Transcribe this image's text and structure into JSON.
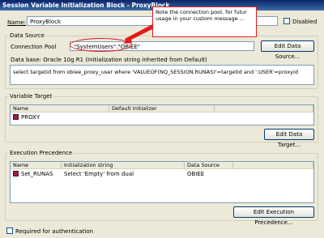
{
  "window": {
    "title": "Session Variable Initialization Block - ProxyBlock"
  },
  "name_label": "Name:",
  "name_value": "ProxyBlock",
  "disabled_label": "Disabled",
  "data_source": {
    "legend": "Data Source",
    "connection_pool_label": "Connection Pool",
    "connection_pool_value": "\"SystemUsers\".\"OBIEE\"",
    "edit_button": "Edit Data Source...",
    "database_text": "Data base: Oracle 10g R1 (Initialization string inherited from Default)",
    "sql": "select targetid from obiee_proxy_user where 'VALUEOF(NQ_SESSION.RUNAS)'=targetid and ':USER'=proxyid"
  },
  "variable_target": {
    "legend": "Variable Target",
    "columns": [
      "Name",
      "Default Initializer"
    ],
    "rows": [
      {
        "name": "PROXY",
        "initializer": ""
      }
    ],
    "edit_button": "Edit Data Target..."
  },
  "execution_precedence": {
    "legend": "Execution Precedence",
    "columns": [
      "Name",
      "Initialization string",
      "Data Source"
    ],
    "rows": [
      {
        "name": "Set_RUNAS",
        "init": "Select 'Empty' from dual",
        "source": "OBIEE"
      }
    ],
    "edit_button": "Edit Execution Precedence..."
  },
  "required_label": "Required for authentication",
  "callout": "Note the connection pool, for futur usage in your custom message ...",
  "colors": {
    "accent": "#e31b1b",
    "title_bar": "#0a246a"
  }
}
